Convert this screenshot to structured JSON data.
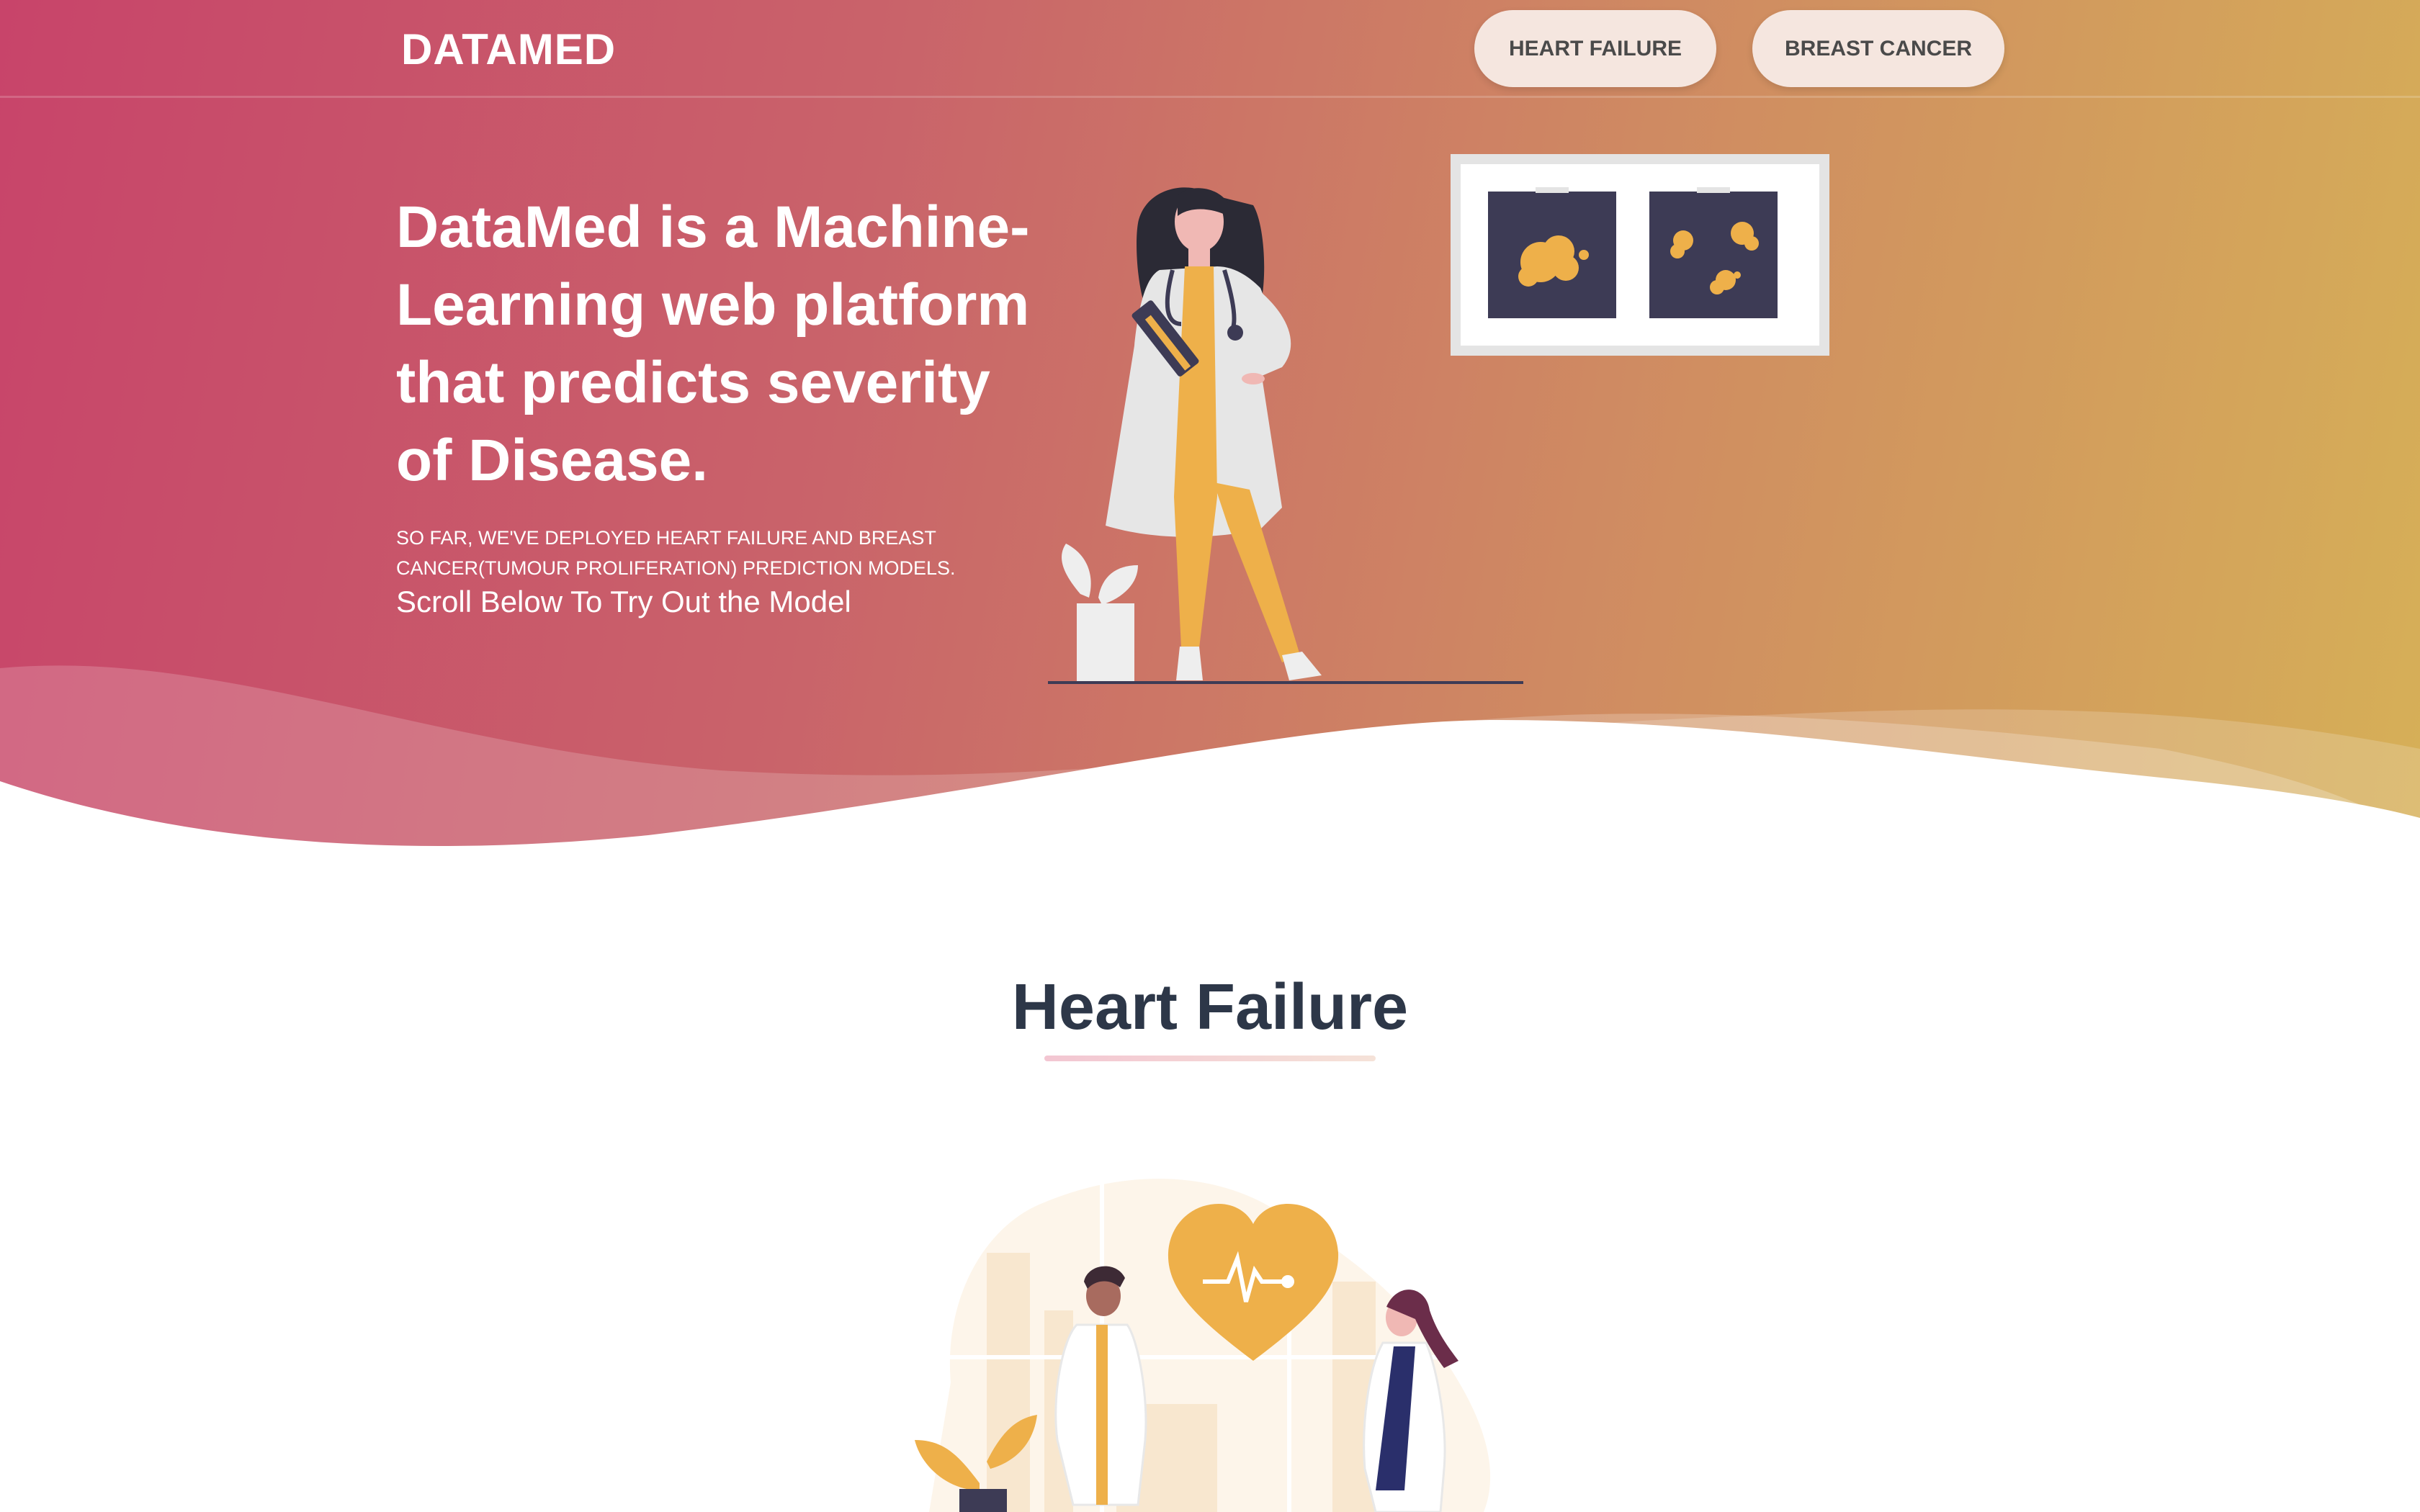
{
  "brand": {
    "logo": "DATAMED"
  },
  "nav": {
    "heart_failure": "HEART FAILURE",
    "breast_cancer": "BREAST CANCER"
  },
  "hero": {
    "headline": "DataMed is a Machine-Learning web platform that predicts severity of Disease.",
    "subline": "SO FAR, WE'VE DEPLOYED HEART FAILURE AND BREAST CANCER(TUMOUR PROLIFERATION) PREDICTION MODELS.",
    "cta": "Scroll Below To Try Out the Model"
  },
  "section": {
    "title": "Heart Failure"
  },
  "icons": {
    "doctor": "doctor-illustration",
    "xray": "xray-frame-illustration",
    "heart": "heart-pulse-icon",
    "plant": "plant-icon"
  },
  "colors": {
    "gradient_start": "#c8446a",
    "gradient_end": "#d6b057",
    "accent": "#eeb04a",
    "dark": "#3d3b55",
    "heading": "#2d3748",
    "button_bg": "#f5e6df"
  }
}
